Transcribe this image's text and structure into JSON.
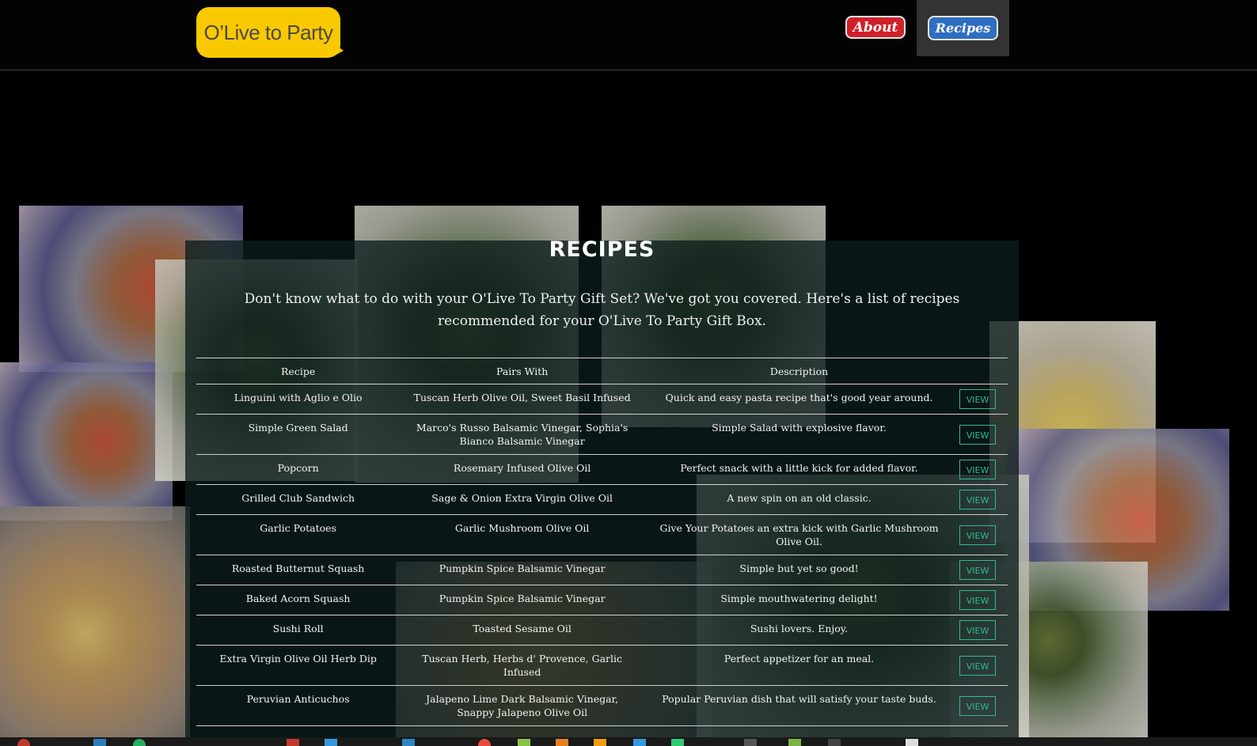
{
  "header": {
    "logo_text": "O’Live to Party",
    "nav": [
      {
        "label": "About",
        "color": "#d0202a"
      },
      {
        "label": "Recipes",
        "color": "#2e6ec2",
        "active": true
      }
    ]
  },
  "main": {
    "title": "RECIPES",
    "intro": "Don't know what to do with your O'Live To Party Gift Set? We've got you covered. Here's a list of recipes recommended for your O'Live To Party Gift Box.",
    "table": {
      "headers": [
        "Recipe",
        "Pairs With",
        "Description"
      ],
      "view_label": "VIEW",
      "rows": [
        {
          "recipe": "Linguini with Aglio e Olio",
          "pairs": "Tuscan Herb Olive Oil, Sweet Basil Infused",
          "desc": "Quick and easy pasta recipe that's good year around."
        },
        {
          "recipe": "Simple Green Salad",
          "pairs": "Marco's Russo Balsamic Vinegar, Sophia's Bianco Balsamic Vinegar",
          "desc": "Simple Salad with explosive flavor."
        },
        {
          "recipe": "Popcorn",
          "pairs": "Rosemary Infused Olive Oil",
          "desc": "Perfect snack with a little kick for added flavor."
        },
        {
          "recipe": "Grilled Club Sandwich",
          "pairs": "Sage & Onion Extra Virgin Olive Oil",
          "desc": "A new spin on an old classic."
        },
        {
          "recipe": "Garlic Potatoes",
          "pairs": "Garlic Mushroom Olive Oil",
          "desc": "Give Your Potatoes an extra kick with Garlic Mushroom Olive Oil."
        },
        {
          "recipe": "Roasted Butternut Squash",
          "pairs": "Pumpkin Spice Balsamic Vinegar",
          "desc": "Simple but yet so good!"
        },
        {
          "recipe": "Baked Acorn Squash",
          "pairs": "Pumpkin Spice Balsamic Vinegar",
          "desc": "Simple mouthwatering delight!"
        },
        {
          "recipe": "Sushi Roll",
          "pairs": "Toasted Sesame Oil",
          "desc": "Sushi lovers. Enjoy."
        },
        {
          "recipe": "Extra Virgin Olive Oil Herb Dip",
          "pairs": "Tuscan Herb, Herbs d' Provence, Garlic Infused",
          "desc": "Perfect appetizer for an meal."
        },
        {
          "recipe": "Peruvian Anticuchos",
          "pairs": "Jalapeno Lime Dark Balsamic Vinegar, Snappy Jalapeno Olive Oil",
          "desc": "Popular Peruvian dish that will satisfy your taste buds."
        }
      ]
    }
  },
  "colors": {
    "logo_bg": "#f9c900",
    "view_button": "#2fb89a",
    "panel_bg": "#0a1c1c"
  }
}
